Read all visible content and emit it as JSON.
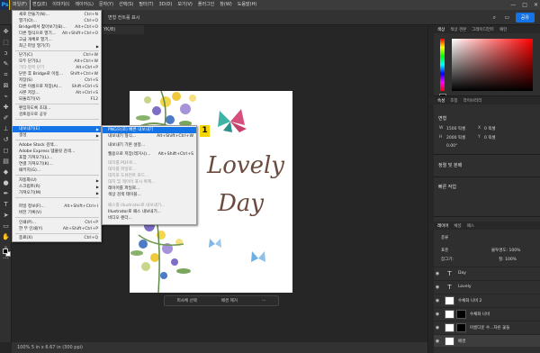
{
  "menubar": {
    "logo": "Ps",
    "items": [
      "파일(F)",
      "편집(E)",
      "이미지(I)",
      "레이어(L)",
      "문자(Y)",
      "선택(S)",
      "필터(T)",
      "3D(D)",
      "보기(V)",
      "플러그인",
      "창(W)",
      "도움말(H)"
    ],
    "window_controls": [
      "—",
      "□",
      "✕"
    ]
  },
  "optionsbar": {
    "label": "변형 컨트롤 표시",
    "share_label": "공유"
  },
  "document_tab": "YK/8)",
  "file_menu": {
    "items": [
      {
        "label": "새로 만들기(N)...",
        "shortcut": "Ctrl+N"
      },
      {
        "label": "열기(O)...",
        "shortcut": "Ctrl+O"
      },
      {
        "label": "Bridge에서 찾아보기(B)...",
        "shortcut": "Alt+Ctrl+O"
      },
      {
        "label": "다른 형식으로 열기...",
        "shortcut": "Alt+Shift+Ctrl+O"
      },
      {
        "label": "고급 개체로 열기...",
        "shortcut": ""
      },
      {
        "label": "최근 파일 열기(T)",
        "shortcut": "",
        "submenu": true
      },
      {
        "label": "닫기(C)",
        "shortcut": "Ctrl+W"
      },
      {
        "label": "모두 닫기(L)",
        "shortcut": "Alt+Ctrl+W"
      },
      {
        "label": "기타 항목 닫기",
        "shortcut": "Alt+Ctrl+P",
        "disabled": true
      },
      {
        "label": "닫은 후 Bridge로 이동...",
        "shortcut": "Shift+Ctrl+W"
      },
      {
        "label": "저장(S)",
        "shortcut": "Ctrl+S"
      },
      {
        "label": "다른 이름으로 저장(A)...",
        "shortcut": "Shift+Ctrl+S"
      },
      {
        "label": "사본 저장...",
        "shortcut": "Alt+Ctrl+S"
      },
      {
        "label": "되돌리기(V)",
        "shortcut": "F12"
      },
      {
        "label": "편집하도록 초대...",
        "shortcut": ""
      },
      {
        "label": "검토용으로 공유",
        "shortcut": ""
      },
      {
        "label": "내보내기(E)",
        "shortcut": "",
        "submenu": true,
        "highlighted": true
      },
      {
        "label": "생성",
        "shortcut": "",
        "submenu": true
      },
      {
        "label": "Adobe Stock 검색...",
        "shortcut": ""
      },
      {
        "label": "Adobe Express 템플릿 검색...",
        "shortcut": ""
      },
      {
        "label": "포함 가져오기(L)...",
        "shortcut": ""
      },
      {
        "label": "연결 가져오기(K)...",
        "shortcut": ""
      },
      {
        "label": "패키지(G)...",
        "shortcut": ""
      },
      {
        "label": "자동화(U)",
        "shortcut": "",
        "submenu": true
      },
      {
        "label": "스크립트(R)",
        "shortcut": "",
        "submenu": true
      },
      {
        "label": "가져오기(M)",
        "shortcut": "",
        "submenu": true
      },
      {
        "label": "파일 정보(F)...",
        "shortcut": "Alt+Shift+Ctrl+I"
      },
      {
        "label": "버전 기록(V)",
        "shortcut": ""
      },
      {
        "label": "인쇄(P)...",
        "shortcut": "Ctrl+P"
      },
      {
        "label": "한 부 인쇄(Y)",
        "shortcut": "Alt+Shift+Ctrl+P"
      },
      {
        "label": "종료(X)",
        "shortcut": "Ctrl+Q"
      }
    ]
  },
  "export_submenu": {
    "items": [
      {
        "label": "PNG으(로) 빠른 내보내기",
        "shortcut": "",
        "highlighted": true
      },
      {
        "label": "내보내기 형식...",
        "shortcut": "Alt+Shift+Ctrl+W"
      },
      {
        "label": "내보내기 기본 설정...",
        "shortcut": ""
      },
      {
        "label": "웹용으로 저장(레거시)...",
        "shortcut": "Alt+Shift+Ctrl+S"
      },
      {
        "label": "대지를 PDF로...",
        "shortcut": "",
        "disabled": true
      },
      {
        "label": "대지를 파일로...",
        "shortcut": "",
        "disabled": true
      },
      {
        "label": "대지로 도큐먼트 로드...",
        "shortcut": "",
        "disabled": true
      },
      {
        "label": "대지 및 레이어 표시 복제...",
        "shortcut": "",
        "disabled": true
      },
      {
        "label": "레이어를 파일로...",
        "shortcut": ""
      },
      {
        "label": "색상 검색 테이블...",
        "shortcut": ""
      },
      {
        "label": "패스를 Illustrator로 내보내기...",
        "shortcut": "",
        "disabled": true
      },
      {
        "label": "Illustrator로 패스 내보내기...",
        "shortcut": ""
      },
      {
        "label": "비디오 렌더...",
        "shortcut": ""
      }
    ]
  },
  "callout_number": "1",
  "document": {
    "line1": "Lovely",
    "line2": "Day"
  },
  "context_taskbar": {
    "btn1": "피사체 선택",
    "btn2": "배경 제거"
  },
  "statusbar": "100%   5 in x 6.67 in (300 ppi)",
  "color_panel": {
    "tabs": [
      "색상",
      "색상 견본",
      "그레이디언트",
      "패턴"
    ],
    "fg_color": "#000000"
  },
  "properties_panel": {
    "tabs": [
      "속성",
      "조정",
      "라이브러리"
    ],
    "section": "변형",
    "w_label": "W",
    "w_value": "1500 픽셀",
    "h_label": "H",
    "h_value": "2000 픽셀",
    "x_label": "X",
    "x_value": "0 픽셀",
    "y_label": "Y",
    "y_value": "0 픽셀",
    "angle_value": "0.00°",
    "align_section": "정렬 및 분배",
    "quick_actions": "빠른 작업"
  },
  "layers_panel": {
    "tabs": [
      "레이어",
      "채널",
      "패스"
    ],
    "filter_label": "종류",
    "blend_mode": "표준",
    "opacity_label": "불투명도: 100%",
    "lock_label": "잠그기:",
    "fill_label": "칠: 100%",
    "layers": [
      {
        "name": "Day",
        "type": "text"
      },
      {
        "name": "Lovely",
        "type": "text"
      },
      {
        "name": "수채화 나비 2",
        "type": "image"
      },
      {
        "name": "수채화 나비",
        "type": "mask"
      },
      {
        "name": "아름다운 수...차린 꽃들",
        "type": "mask"
      },
      {
        "name": "배경",
        "type": "bg"
      }
    ]
  }
}
